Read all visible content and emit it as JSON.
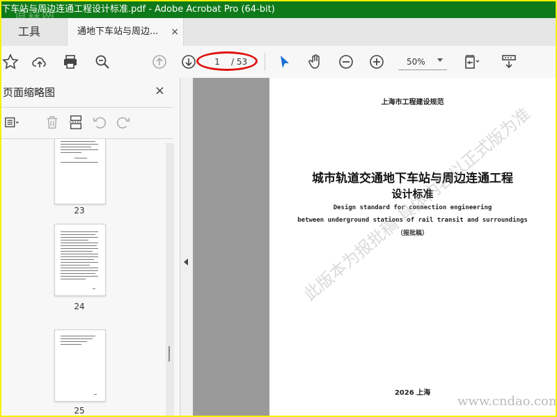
{
  "window": {
    "title": "下车站与周边连通工程设计标准.pdf - Adobe Acrobat Pro (64-bit)",
    "watermark": "道森网"
  },
  "tabs": {
    "tools_label": "工具",
    "document_label": "通地下车站与周边...",
    "close_symbol": "×"
  },
  "toolbar": {
    "current_page": "1",
    "total_pages": "/ 53",
    "zoom": "50%",
    "highlight_color": "#e01010",
    "accent_color": "#1a6fd6"
  },
  "sidebar": {
    "title": "页面缩略图",
    "close_symbol": "×",
    "thumbnails": [
      {
        "page": "23"
      },
      {
        "page": "24"
      },
      {
        "page": "25"
      }
    ]
  },
  "document": {
    "org": "上海市工程建设规范",
    "title_line1": "城市轨道交通地下车站与周边连通工程",
    "title_line2": "设计标准",
    "english_line1": "Design standard for connection engineering",
    "english_line2": "between underground stations of rail transit and surroundings",
    "status": "（报批稿）",
    "place_year": "2026  上海",
    "diagonal_watermark": "此版本为报批稿 具体内容以正式版为准",
    "site_watermark": "www.cndao.com"
  }
}
